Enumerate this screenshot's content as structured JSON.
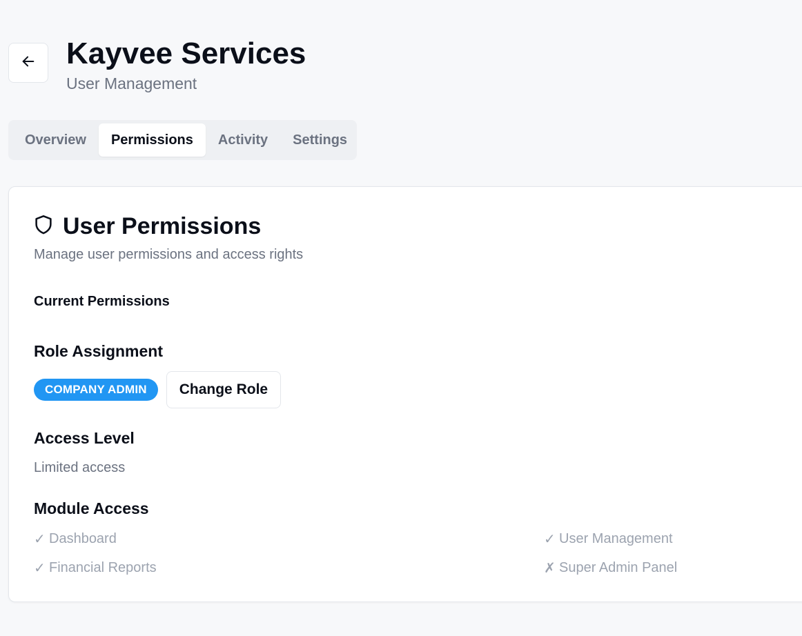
{
  "header": {
    "back_icon": "arrow-left-icon",
    "title": "Kayvee Services",
    "subtitle": "User Management"
  },
  "tabs": [
    {
      "label": "Overview",
      "active": false
    },
    {
      "label": "Permissions",
      "active": true
    },
    {
      "label": "Activity",
      "active": false
    },
    {
      "label": "Settings",
      "active": false
    }
  ],
  "card": {
    "icon": "shield-icon",
    "title": "User Permissions",
    "description": "Manage user permissions and access rights",
    "current_permissions_label": "Current Permissions",
    "role": {
      "heading": "Role Assignment",
      "badge": "COMPANY ADMIN",
      "badge_color": "#2196f3",
      "change_button": "Change Role"
    },
    "access": {
      "heading": "Access Level",
      "value": "Limited access"
    },
    "modules": {
      "heading": "Module Access",
      "items": [
        {
          "mark": "✓",
          "label": "Dashboard"
        },
        {
          "mark": "✓",
          "label": "User Management"
        },
        {
          "mark": "✓",
          "label": "Financial Reports"
        },
        {
          "mark": "✗",
          "label": "Super Admin Panel"
        }
      ]
    }
  }
}
